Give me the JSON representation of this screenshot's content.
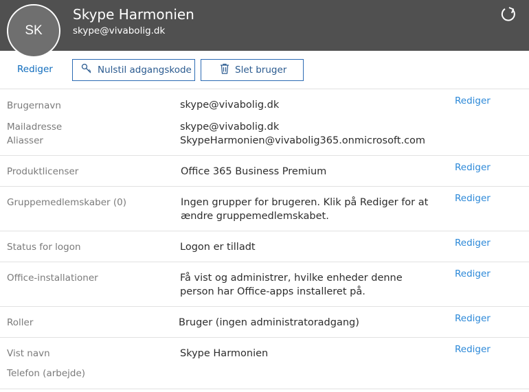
{
  "header": {
    "initials": "SK",
    "name": "Skype Harmonien",
    "email": "skype@vivabolig.dk"
  },
  "toolbar": {
    "edit_label": "Rediger",
    "reset_password_label": "Nulstil adgangskode",
    "delete_user_label": "Slet bruger"
  },
  "details": {
    "username": {
      "label": "Brugernavn",
      "value": "skype@vivabolig.dk",
      "edit": "Rediger"
    },
    "mail": {
      "label": "Mailadresse",
      "value": "skype@vivabolig.dk"
    },
    "aliases": {
      "label": "Aliasser",
      "value": "SkypeHarmonien@vivabolig365.onmicrosoft.com"
    },
    "licenses": {
      "label": "Produktlicenser",
      "value": "Office 365 Business Premium",
      "edit": "Rediger"
    },
    "groups": {
      "label": "Gruppemedlemskaber (0)",
      "value_line1": "Ingen grupper for brugeren. Klik på Rediger for at",
      "value_line2": "ændre gruppemedlemskabet.",
      "edit": "Rediger"
    },
    "logon": {
      "label": "Status for logon",
      "value": "Logon er tilladt",
      "edit": "Rediger"
    },
    "office": {
      "label": "Office-installationer",
      "value_line1": "Få vist og administrer, hvilke enheder denne",
      "value_line2": "person har Office-apps installeret på.",
      "edit": "Rediger"
    },
    "roles": {
      "label": "Roller",
      "value": "Bruger (ingen administratoradgang)",
      "edit": "Rediger"
    },
    "display_name": {
      "label": "Vist navn",
      "value": "Skype Harmonien",
      "edit": "Rediger"
    },
    "phone": {
      "label": "Telefon (arbejde)"
    }
  }
}
